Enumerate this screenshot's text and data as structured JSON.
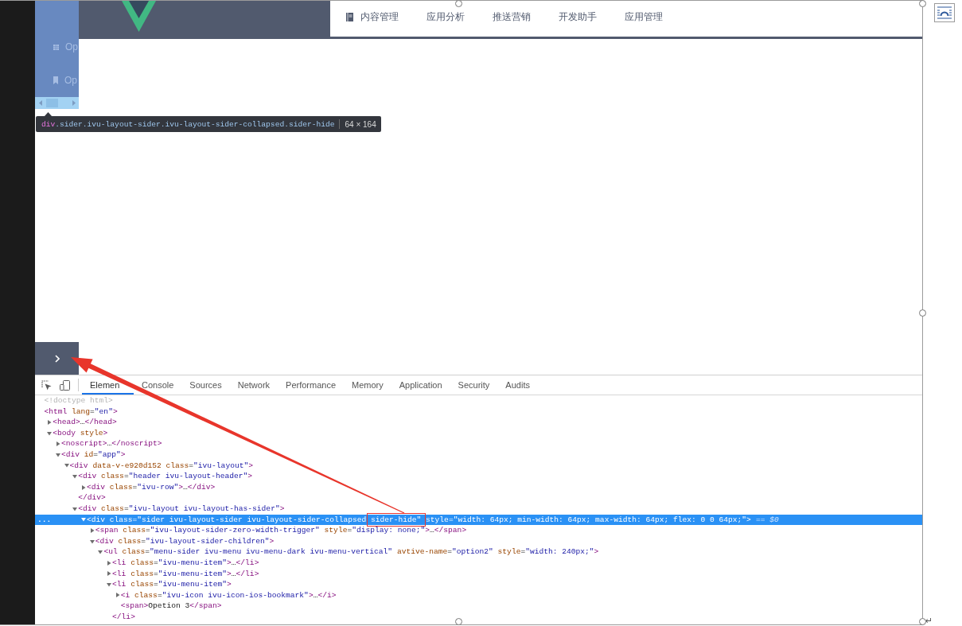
{
  "document": {
    "paragraph_mark": "↵"
  },
  "page": {
    "header": {
      "nav": [
        {
          "label": "内容管理"
        },
        {
          "label": "应用分析"
        },
        {
          "label": "推送营销"
        },
        {
          "label": "开发助手"
        },
        {
          "label": "应用管理"
        }
      ]
    },
    "sider": {
      "items": [
        {
          "label": "Op"
        },
        {
          "label": "Op"
        }
      ]
    },
    "inspect_tooltip": {
      "tag": "div",
      "classes": ".sider.ivu-layout-sider.ivu-layout-sider-collapsed.sider-hide",
      "size": "64 × 164"
    }
  },
  "devtools": {
    "tabs": [
      {
        "label": "Elemen",
        "selected": true
      },
      {
        "label": "Console",
        "selected": false
      },
      {
        "label": "Sources",
        "selected": false
      },
      {
        "label": "Network",
        "selected": false
      },
      {
        "label": "Performance",
        "selected": false
      },
      {
        "label": "Memory",
        "selected": false
      },
      {
        "label": "Application",
        "selected": false
      },
      {
        "label": "Security",
        "selected": false
      },
      {
        "label": "Audits",
        "selected": false
      }
    ],
    "dom": [
      {
        "markup": "<!doctype html>",
        "selected": false
      },
      {
        "markup": "<html lang=\"en\">",
        "selected": false,
        "children": [
          {
            "markup": "<head>…</head>",
            "expanded": false,
            "selected": false
          },
          {
            "markup": "<body style>",
            "expanded": true,
            "selected": false,
            "children": [
              {
                "markup": "<noscript>…</noscript>",
                "expanded": false,
                "selected": false
              },
              {
                "markup": "<div id=\"app\">",
                "expanded": true,
                "selected": false,
                "children": [
                  {
                    "markup": "<div data-v-e920d152 class=\"ivu-layout\">",
                    "expanded": true,
                    "selected": false,
                    "children": [
                      {
                        "markup": "<div class=\"header ivu-layout-header\">",
                        "expanded": true,
                        "selected": false,
                        "closing": "</div>",
                        "children": [
                          {
                            "markup": "<div class=\"ivu-row\">…</div>",
                            "expanded": false,
                            "selected": false
                          }
                        ]
                      },
                      {
                        "markup": "<div class=\"ivu-layout ivu-layout-has-sider\">",
                        "expanded": true,
                        "selected": false,
                        "children": [
                          {
                            "markup": "<div class=\"sider ivu-layout-sider ivu-layout-sider-collapsed sider-hide\" style=\"width: 64px; min-width: 64px; max-width: 64px; flex: 0 0 64px;\">",
                            "expanded": true,
                            "selected": true,
                            "more": "...",
                            "suffix": "== $0",
                            "children": [
                              {
                                "markup": "<span class=\"ivu-layout-sider-zero-width-trigger\" style=\"display: none;\">…</span>",
                                "expanded": false,
                                "selected": false
                              },
                              {
                                "markup": "<div class=\"ivu-layout-sider-children\">",
                                "expanded": true,
                                "selected": false,
                                "children": [
                                  {
                                    "markup": "<ul class=\"menu-sider ivu-menu ivu-menu-dark ivu-menu-vertical\" avtive-name=\"option2\" style=\"width: 240px;\">",
                                    "expanded": true,
                                    "selected": false,
                                    "children": [
                                      {
                                        "markup": "<li class=\"ivu-menu-item\">…</li>",
                                        "expanded": false,
                                        "selected": false
                                      },
                                      {
                                        "markup": "<li class=\"ivu-menu-item\">…</li>",
                                        "expanded": false,
                                        "selected": false
                                      },
                                      {
                                        "markup": "<li class=\"ivu-menu-item\">",
                                        "expanded": true,
                                        "selected": false,
                                        "closing": "</li>",
                                        "children": [
                                          {
                                            "markup": "<i class=\"ivu-icon ivu-icon-ios-bookmark\">…</i>",
                                            "expanded": false,
                                            "selected": false
                                          },
                                          {
                                            "markup": "<span>Opetion 3</span>",
                                            "selected": false
                                          }
                                        ]
                                      }
                                    ]
                                  }
                                ]
                              }
                            ]
                          }
                        ]
                      }
                    ]
                  }
                ]
              }
            ]
          }
        ]
      }
    ]
  }
}
